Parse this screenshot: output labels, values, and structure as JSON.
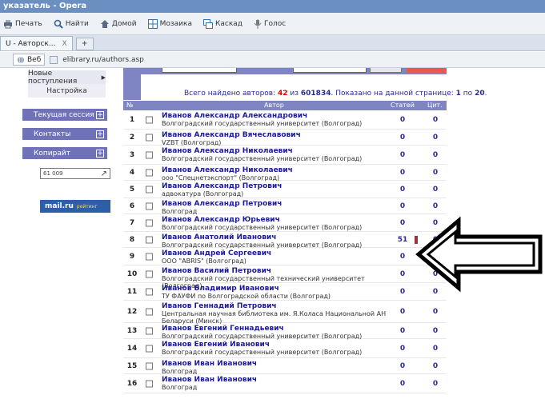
{
  "window": {
    "title": "указатель - Opera"
  },
  "toolbar": {
    "print": "Печать",
    "find": "Найти",
    "home": "Домой",
    "mosaic": "Мозаика",
    "cascade": "Каскад",
    "voice": "Голос"
  },
  "tab": {
    "label": "U - Авторск...",
    "close": "X",
    "add": "+"
  },
  "address": {
    "web_label": "Веб",
    "url": "elibrary.ru/authors.asp"
  },
  "leftnav": {
    "item1": "Новые поступления",
    "item1_arrow": "▶",
    "item2": "Настройка",
    "buttons": [
      "Текущая сессия",
      "Контакты",
      "Копирайт"
    ],
    "counter_text": "61 009",
    "counter_arrow": "↗",
    "mailru": "mail.ru",
    "mailru_small": "рейтинг"
  },
  "summary": {
    "prefix": "Всего найдено авторов: ",
    "found": "42",
    "of": " из ",
    "total": "601834",
    "shown": ". Показано на данной странице: ",
    "from": "1",
    "to_word": " по ",
    "to": "20",
    "dot": "."
  },
  "table": {
    "headers": {
      "num": "№",
      "author": "Автор",
      "articles": "Статей",
      "citations": "Цит."
    },
    "rows": [
      {
        "n": "1",
        "name": "Иванов Александр Александрович",
        "aff": "Волгоградский государственный университет (Волгоград)",
        "art": "0",
        "cit": "0"
      },
      {
        "n": "2",
        "name": "Иванов Александр Вячеславович",
        "aff": "VZBT (Волгоград)",
        "art": "0",
        "cit": "0"
      },
      {
        "n": "3",
        "name": "Иванов Александр Николаевич",
        "aff": "Волгоградский государственный университет (Волгоград)",
        "art": "0",
        "cit": "0"
      },
      {
        "n": "4",
        "name": "Иванов Александр Николаевич",
        "aff": "ооо \"Спецнетэкспорт\" (Волгоград)",
        "art": "0",
        "cit": "0"
      },
      {
        "n": "5",
        "name": "Иванов Александр Петрович",
        "aff": "адвокатура (Волгоград)",
        "art": "0",
        "cit": "0"
      },
      {
        "n": "6",
        "name": "Иванов Александр Петрович",
        "aff": "Волгоград",
        "art": "0",
        "cit": "0"
      },
      {
        "n": "7",
        "name": "Иванов Александр Юрьевич",
        "aff": "Волгоградский государственный университет (Волгоград)",
        "art": "0",
        "cit": "0"
      },
      {
        "n": "8",
        "name": "Иванов Анатолий Иванович",
        "aff": "Волгоградский государственный университет (Волгоград)",
        "art": "51",
        "cit": "0"
      },
      {
        "n": "9",
        "name": "Иванов Андрей Сергеевич",
        "aff": "ООО \"ABRIS\" (Волгоград)",
        "art": "0",
        "cit": "0"
      },
      {
        "n": "10",
        "name": "Иванов Василий Петрович",
        "aff": "Волгоградский государственный технический университет (Волгоград)",
        "art": "0",
        "cit": "0"
      },
      {
        "n": "11",
        "name": "Иванов Владимир Иванович",
        "aff": "ТУ ФАУФИ по Волгоградской области (Волгоград)",
        "art": "0",
        "cit": "0"
      },
      {
        "n": "12",
        "name": "Иванов Геннадий Петрович",
        "aff": "Центральная научная библиотека им. Я.Коласа Национальной АН Беларуси (Минск)",
        "art": "0",
        "cit": "0"
      },
      {
        "n": "13",
        "name": "Иванов Евгений Геннадьевич",
        "aff": "Волгоградский государственный университет (Волгоград)",
        "art": "0",
        "cit": "0"
      },
      {
        "n": "14",
        "name": "Иванов Евгений Иванович",
        "aff": "Волгоградский государственный университет (Волгоград)",
        "art": "0",
        "cit": "0"
      },
      {
        "n": "15",
        "name": "Иванов Иван Иванович",
        "aff": "Волгоград",
        "art": "0",
        "cit": "0"
      },
      {
        "n": "16",
        "name": "Иванов Иван Иванович",
        "aff": "Волгоград",
        "art": "0",
        "cit": "0"
      }
    ]
  },
  "colors": {
    "accent": "#7f84c2",
    "link": "#1d1d8f",
    "highlight": "#dd0000"
  }
}
